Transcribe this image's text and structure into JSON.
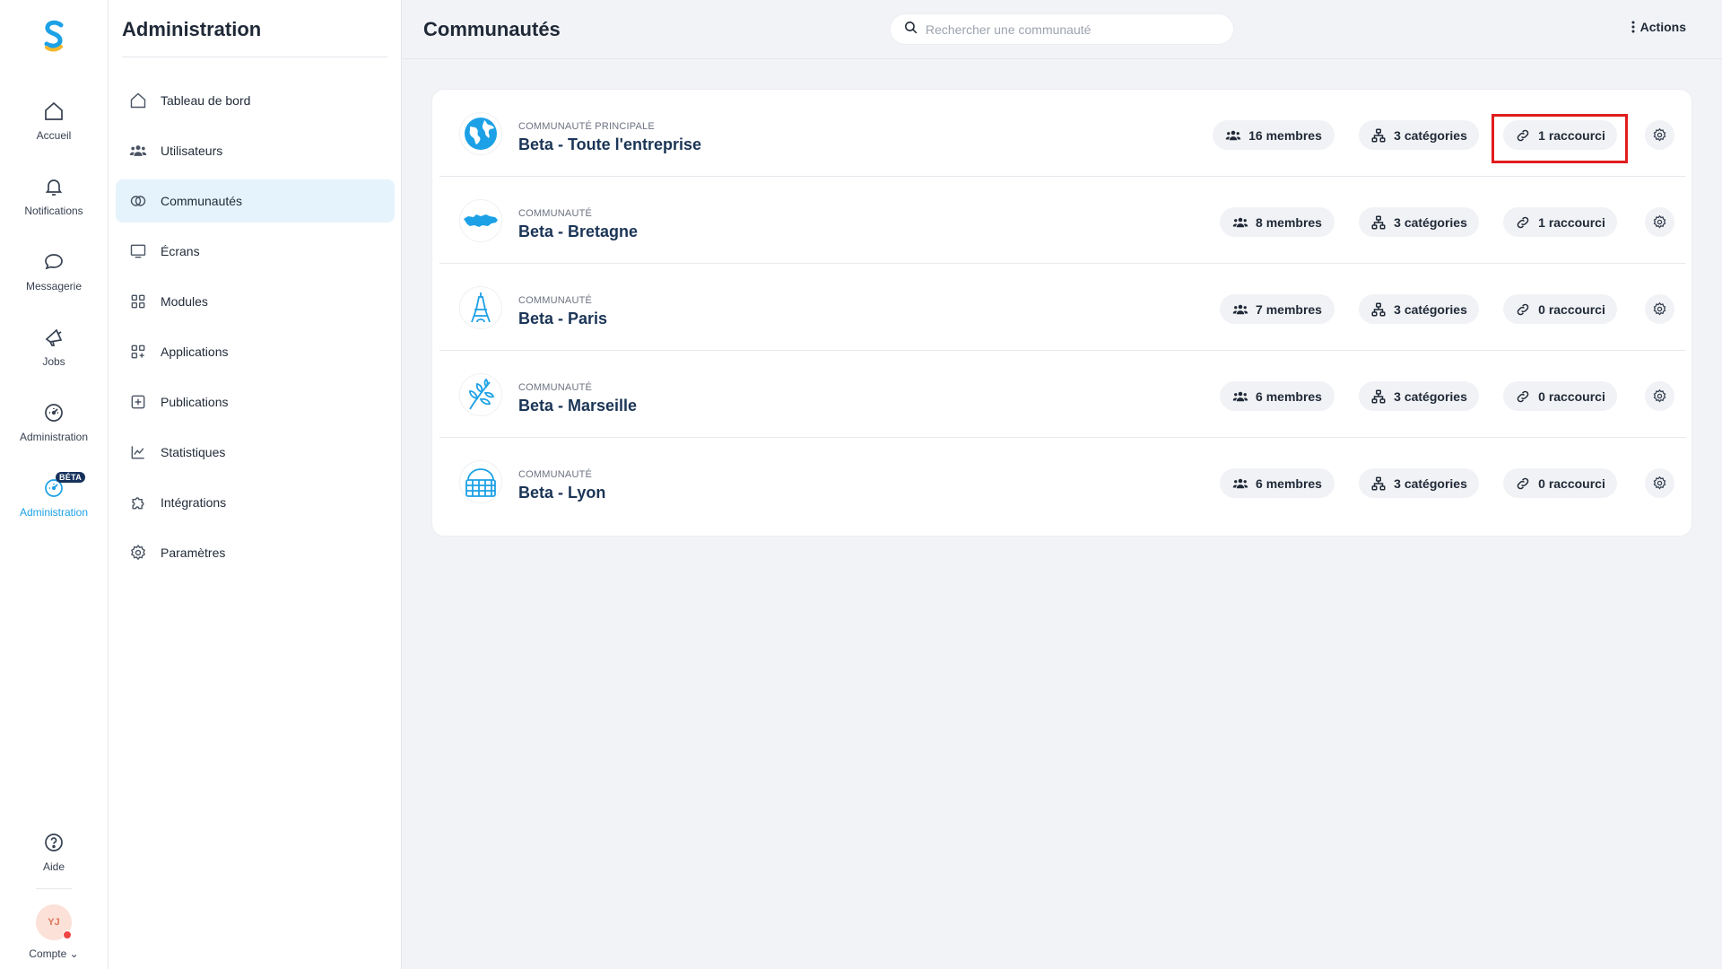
{
  "rail": {
    "items": [
      {
        "label": "Accueil",
        "icon": "home-icon"
      },
      {
        "label": "Notifications",
        "icon": "bell-icon"
      },
      {
        "label": "Messagerie",
        "icon": "chat-icon"
      },
      {
        "label": "Jobs",
        "icon": "megaphone-icon"
      },
      {
        "label": "Administration",
        "icon": "gauge-icon"
      },
      {
        "label": "Administration",
        "icon": "gauge-icon",
        "badge": "BÉTA",
        "active": true
      }
    ],
    "help_label": "Aide",
    "account_initials": "YJ",
    "account_label": "Compte ⌄"
  },
  "admin": {
    "title": "Administration",
    "menu": [
      {
        "label": "Tableau de bord",
        "icon": "home-icon"
      },
      {
        "label": "Utilisateurs",
        "icon": "users-icon"
      },
      {
        "label": "Communautés",
        "icon": "rings-icon",
        "active": true
      },
      {
        "label": "Écrans",
        "icon": "monitor-icon"
      },
      {
        "label": "Modules",
        "icon": "grid-icon"
      },
      {
        "label": "Applications",
        "icon": "apps-icon"
      },
      {
        "label": "Publications",
        "icon": "plus-square-icon"
      },
      {
        "label": "Statistiques",
        "icon": "chart-icon"
      },
      {
        "label": "Intégrations",
        "icon": "puzzle-icon"
      },
      {
        "label": "Paramètres",
        "icon": "gear-icon"
      }
    ]
  },
  "header": {
    "title": "Communautés",
    "search_placeholder": "Rechercher une communauté",
    "actions_label": "Actions"
  },
  "communities": [
    {
      "kind": "COMMUNAUTÉ PRINCIPALE",
      "name": "Beta - Toute l'entreprise",
      "icon": "globe-icon",
      "members": "16 membres",
      "categories": "3 catégories",
      "shortcuts": "1 raccourci"
    },
    {
      "kind": "COMMUNAUTÉ",
      "name": "Beta - Bretagne",
      "icon": "bretagne-map-icon",
      "members": "8 membres",
      "categories": "3 catégories",
      "shortcuts": "1 raccourci"
    },
    {
      "kind": "COMMUNAUTÉ",
      "name": "Beta - Paris",
      "icon": "eiffel-tower-icon",
      "members": "7 membres",
      "categories": "3 catégories",
      "shortcuts": "0 raccourci"
    },
    {
      "kind": "COMMUNAUTÉ",
      "name": "Beta - Marseille",
      "icon": "wheat-icon",
      "members": "6 membres",
      "categories": "3 catégories",
      "shortcuts": "0 raccourci"
    },
    {
      "kind": "COMMUNAUTÉ",
      "name": "Beta - Lyon",
      "icon": "basket-icon",
      "members": "6 membres",
      "categories": "3 catégories",
      "shortcuts": "0 raccourci"
    }
  ],
  "colors": {
    "accent": "#1da1e6",
    "highlight": "#e11d1d",
    "title_text": "#1b3556"
  }
}
